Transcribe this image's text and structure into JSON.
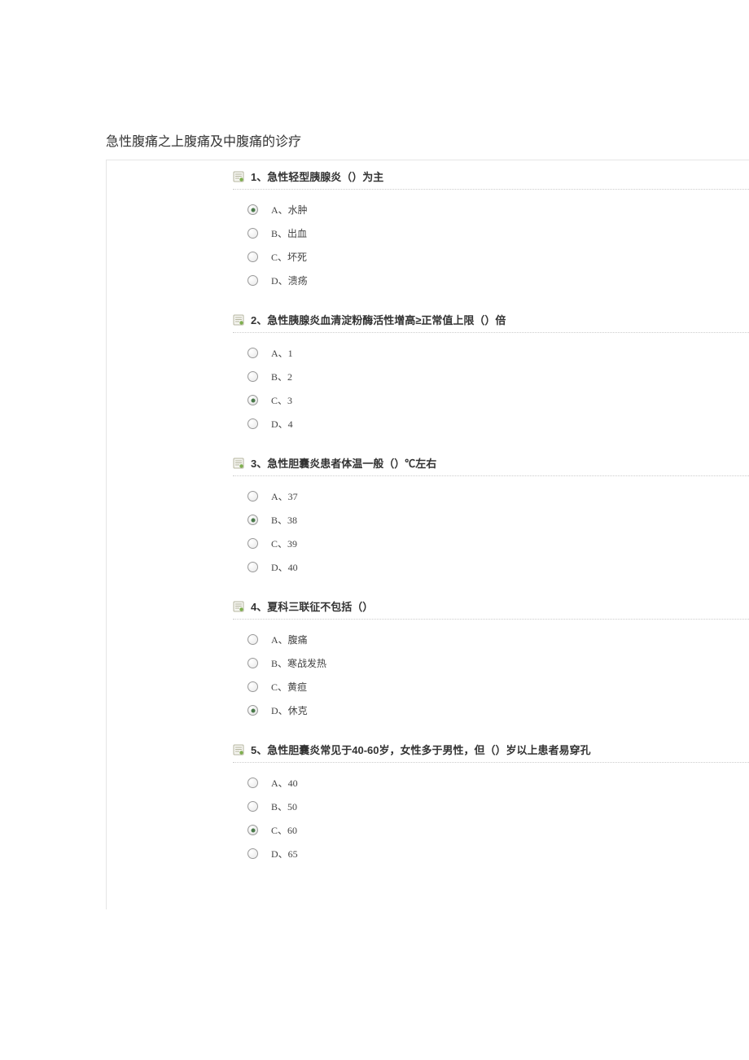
{
  "page_title": "急性腹痛之上腹痛及中腹痛的诊疗",
  "questions": [
    {
      "number": "1、",
      "text": "急性轻型胰腺炎（）为主",
      "selected_index": 0,
      "options": [
        "A、水肿",
        "B、出血",
        "C、坏死",
        "D、溃疡"
      ]
    },
    {
      "number": "2、",
      "text": "急性胰腺炎血清淀粉酶活性增高≥正常值上限（）倍",
      "selected_index": 2,
      "options": [
        "A、1",
        "B、2",
        "C、3",
        "D、4"
      ]
    },
    {
      "number": "3、",
      "text": "急性胆囊炎患者体温一般（）℃左右",
      "selected_index": 1,
      "options": [
        "A、37",
        "B、38",
        "C、39",
        "D、40"
      ]
    },
    {
      "number": "4、",
      "text": "夏科三联征不包括（）",
      "selected_index": 3,
      "options": [
        "A、腹痛",
        "B、寒战发热",
        "C、黄疸",
        "D、休克"
      ]
    },
    {
      "number": "5、",
      "text": "急性胆囊炎常见于40-60岁，女性多于男性，但（）岁以上患者易穿孔",
      "selected_index": 2,
      "options": [
        "A、40",
        "B、50",
        "C、60",
        "D、65"
      ]
    }
  ]
}
